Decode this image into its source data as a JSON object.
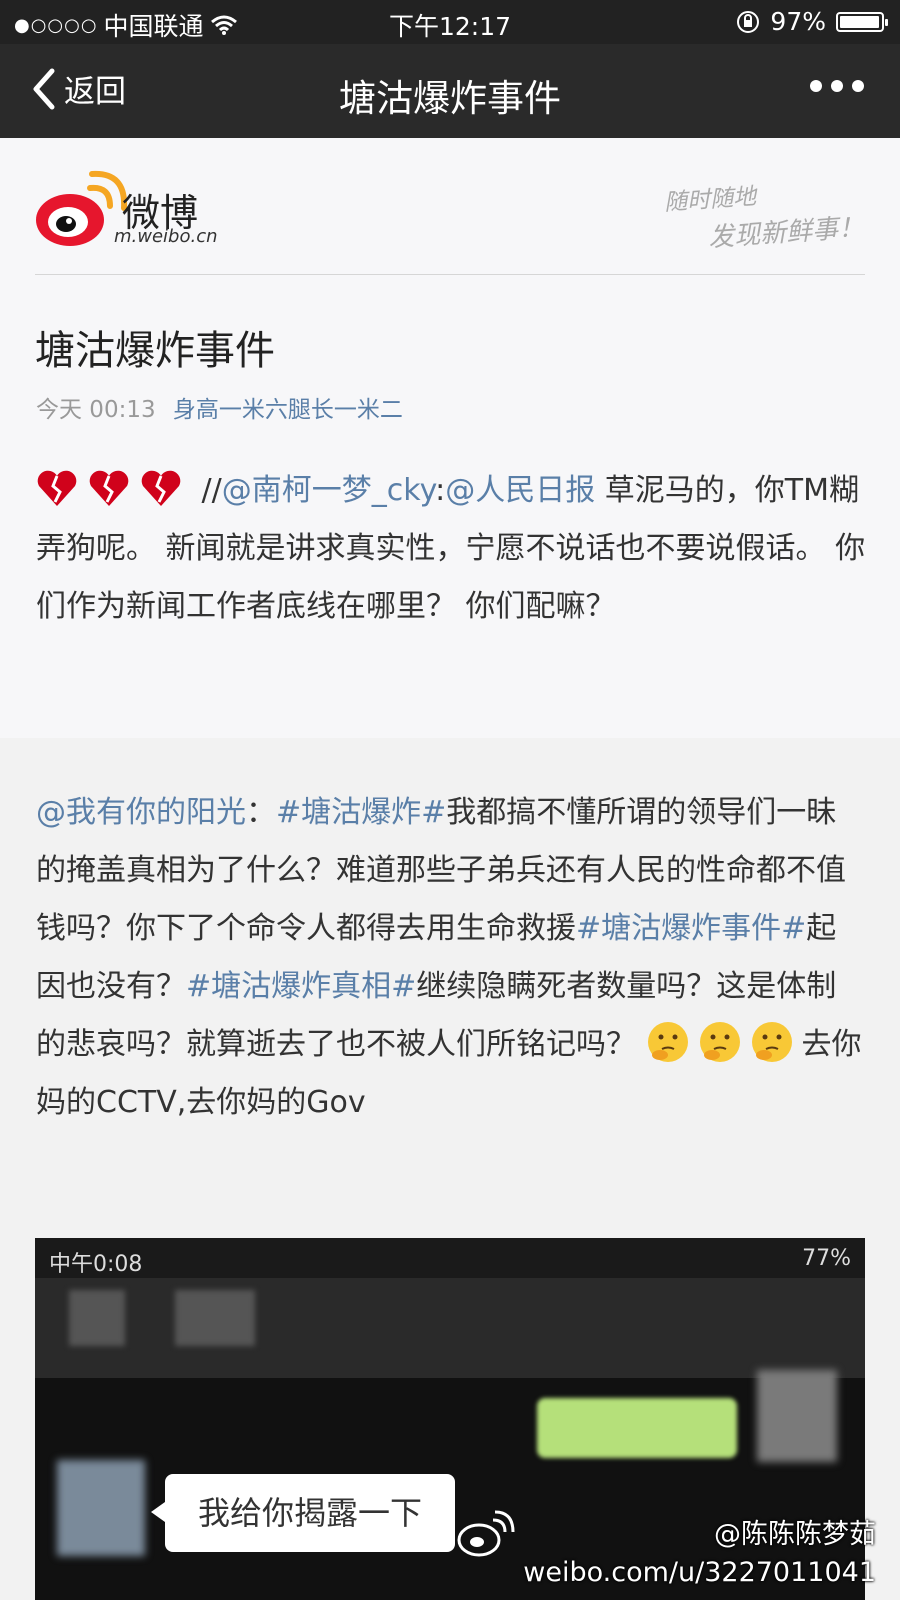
{
  "status_bar": {
    "carrier": "中国联通",
    "time": "下午12:17",
    "battery": "97%",
    "battery_level": 0.97
  },
  "nav": {
    "back_label": "返回",
    "title": "塘沽爆炸事件"
  },
  "brand": {
    "name": "微博",
    "domain": "m.weibo.cn",
    "slogan_line1": "随时随地",
    "slogan_line2": "发现新鲜事！"
  },
  "article": {
    "title": "塘沽爆炸事件",
    "date": "今天 00:13",
    "author": "身高一米六腿长一米二",
    "sep": " //",
    "mention1": "@南柯一梦_cky",
    "colon": ":",
    "mention2": "@人民日报",
    "text": " 草泥马的，你TM糊弄狗呢。 新闻就是讲求真实性，宁愿不说话也不要说假话。 你们作为新闻工作者底线在哪里？ 你们配嘛？"
  },
  "comment": {
    "user": "@我有你的阳光",
    "colon": "：",
    "tag1": "#塘沽爆炸#",
    "text1": "我都搞不懂所谓的领导们一昧的掩盖真相为了什么？难道那些子弟兵还有人民的性命都不值钱吗？你下了个命令人都得去用生命救援",
    "tag2": "#塘沽爆炸事件#",
    "text2": "起因也没有？",
    "tag3": "#塘沽爆炸真相#",
    "text3": "继续隐瞒死者数量吗？这是体制的悲哀吗？就算逝去了也不被人们所铭记吗？ ",
    "text4": "去你妈的CCTV,去你妈的Gov"
  },
  "embedded_screenshot": {
    "time": "中午0:08",
    "battery": "77%",
    "bubble": "我给你揭露一下"
  },
  "watermark": {
    "user": "@陈陈陈梦茹",
    "url": "weibo.com/u/3227011041"
  },
  "colors": {
    "link": "#5a7fa8",
    "nav_bg": "#2a2a2a",
    "weibo_red": "#e6162d",
    "weibo_orange": "#f5a623"
  }
}
